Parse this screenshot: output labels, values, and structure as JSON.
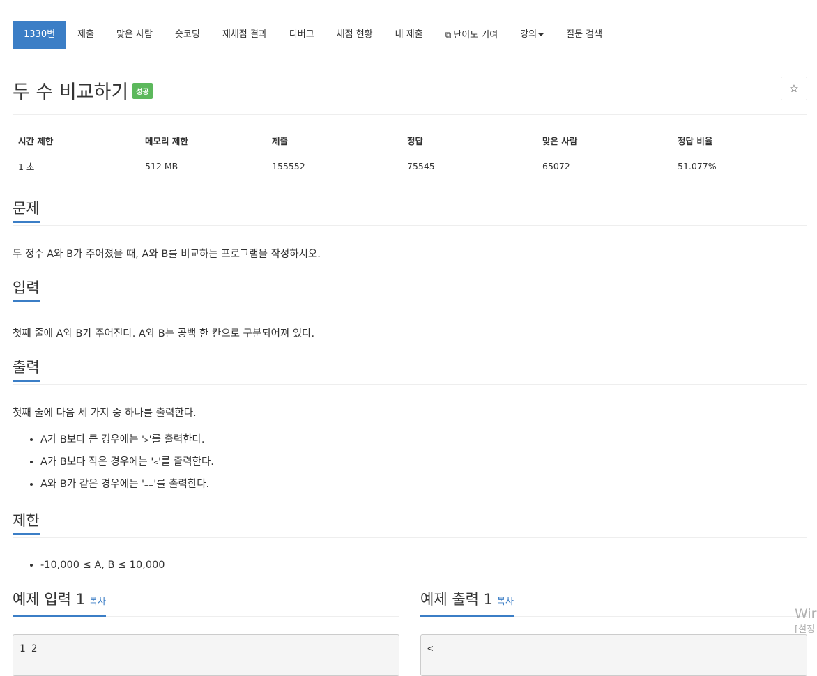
{
  "tabs": [
    {
      "label": "1330번",
      "active": true
    },
    {
      "label": "제출"
    },
    {
      "label": "맞은 사람"
    },
    {
      "label": "숏코딩"
    },
    {
      "label": "재채점 결과"
    },
    {
      "label": "디버그"
    },
    {
      "label": "채점 현황"
    },
    {
      "label": "내 제출"
    },
    {
      "label": "난이도 기여",
      "icon": "external-link-icon"
    },
    {
      "label": "강의",
      "dropdown": true
    },
    {
      "label": "질문 검색"
    }
  ],
  "problem": {
    "title": "두 수 비교하기",
    "status_badge": "성공",
    "status_color": "#5cb85c",
    "accent_color": "#3b7ec6",
    "star_icon": "☆"
  },
  "stats": {
    "headers": [
      "시간 제한",
      "메모리 제한",
      "제출",
      "정답",
      "맞은 사람",
      "정답 비율"
    ],
    "values": [
      "1 초",
      "512 MB",
      "155552",
      "75545",
      "65072",
      "51.077%"
    ]
  },
  "sections": {
    "problem": {
      "heading": "문제",
      "text": "두 정수 A와 B가 주어졌을 때, A와 B를 비교하는 프로그램을 작성하시오."
    },
    "input": {
      "heading": "입력",
      "text": "첫째 줄에 A와 B가 주어진다. A와 B는 공백 한 칸으로 구분되어져 있다."
    },
    "output": {
      "heading": "출력",
      "text": "첫째 줄에 다음 세 가지 중 하나를 출력한다.",
      "items": [
        {
          "before": "A가 B보다 큰 경우에는 '",
          "op": ">",
          "after": "'를 출력한다."
        },
        {
          "before": "A가 B보다 작은 경우에는 '",
          "op": "<",
          "after": "'를 출력한다."
        },
        {
          "before": "A와 B가 같은 경우에는 '",
          "op": "==",
          "after": "'를 출력한다."
        }
      ]
    },
    "limits": {
      "heading": "제한",
      "items": [
        "-10,000 ≤ A, B ≤ 10,000"
      ]
    }
  },
  "samples": {
    "input_heading": "예제 입력 1",
    "output_heading": "예제 출력 1",
    "copy_label": "복사",
    "input_value": "1 2",
    "output_value": "<"
  },
  "watermark": {
    "line1": "Wir",
    "line2": "[설정"
  }
}
